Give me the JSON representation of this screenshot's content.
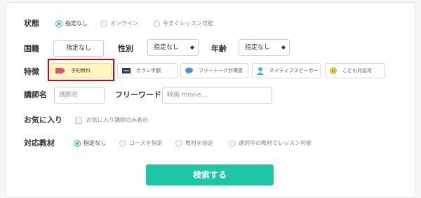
{
  "colors": {
    "accent": "#2ab7a9",
    "button": "#1ec6a5",
    "highlight": "#d0021b",
    "chip_active_bg": "#fff7bf"
  },
  "status": {
    "label": "状態",
    "options": [
      {
        "label": "指定なし",
        "selected": true
      },
      {
        "label": "オンライン",
        "selected": false
      },
      {
        "label": "今すぐレッスン可能",
        "selected": false
      }
    ]
  },
  "nationality": {
    "label": "国籍",
    "value": "指定なし"
  },
  "gender": {
    "label": "性別",
    "value": "指定なし"
  },
  "age": {
    "label": "年齢",
    "value": "指定なし"
  },
  "features": {
    "label": "特徴",
    "chips": [
      {
        "label": "予約無料",
        "icon": "tag-icon",
        "active": true
      },
      {
        "label": "カラン半額",
        "icon": "callan-logo-icon",
        "active": false
      },
      {
        "label": "フリートークが得意",
        "icon": "speech-bubble-icon",
        "active": false
      },
      {
        "label": "ネイティブスピーカー",
        "icon": "person-icon",
        "active": false
      },
      {
        "label": "こども対応可",
        "icon": "smiley-icon",
        "active": false
      }
    ]
  },
  "teacher_name": {
    "label": "講師名",
    "placeholder": "講師名"
  },
  "free_word": {
    "label": "フリーワード",
    "placeholder": "映画 movie..."
  },
  "favorites": {
    "label": "お気に入り",
    "checkbox_label": "お気に入り講師のみ表示",
    "checked": false
  },
  "materials": {
    "label": "対応教材",
    "options": [
      {
        "label": "指定なし",
        "selected": true
      },
      {
        "label": "コースを指定",
        "selected": false
      },
      {
        "label": "教材を指定",
        "selected": false
      },
      {
        "label": "選択中の教材でレッスン可能",
        "selected": false
      }
    ]
  },
  "search_button": {
    "label": "検索する"
  }
}
